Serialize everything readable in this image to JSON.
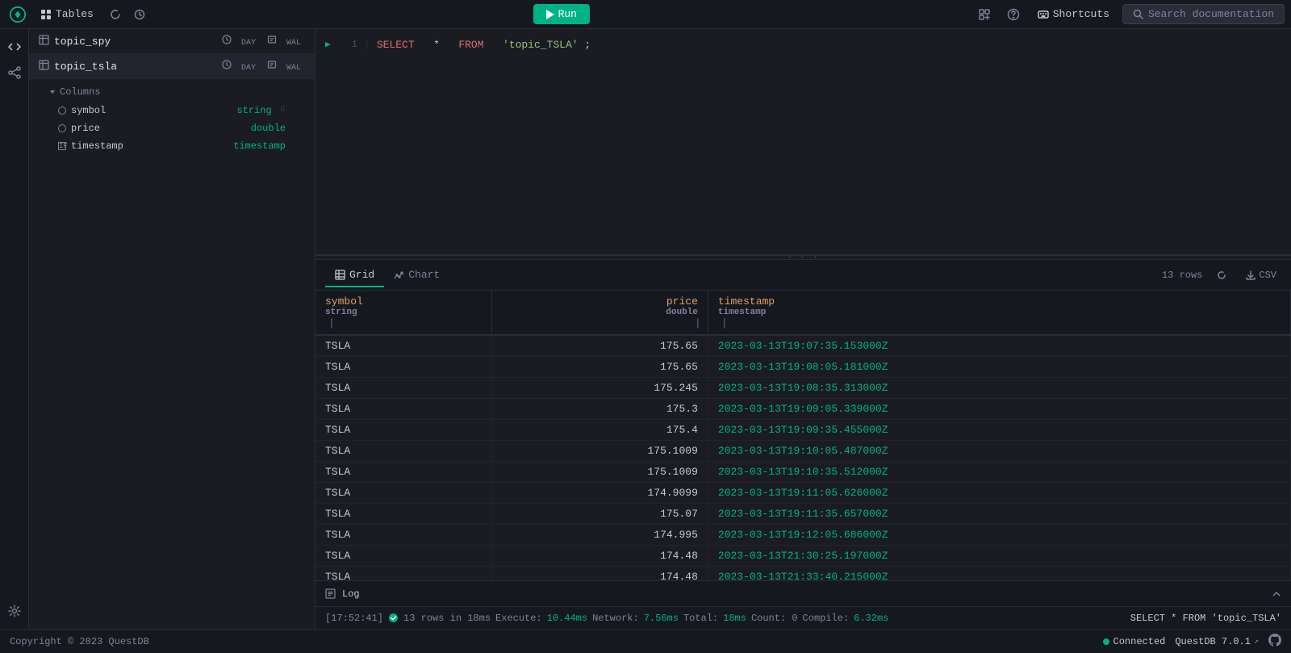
{
  "topNav": {
    "tablesLabel": "Tables",
    "runLabel": "Run",
    "shortcutsLabel": "Shortcuts",
    "searchDocLabel": "Search documentation"
  },
  "sidebar": {
    "icons": [
      "code",
      "share",
      "settings"
    ]
  },
  "tablesPanel": {
    "tables": [
      {
        "name": "topic_spy",
        "badge1": "DAY",
        "badge2": "WAL"
      },
      {
        "name": "topic_tsla",
        "badge1": "DAY",
        "badge2": "WAL",
        "expanded": true
      }
    ],
    "columnsHeader": "Columns",
    "columns": [
      {
        "name": "symbol",
        "type": "string",
        "indicator": "circle"
      },
      {
        "name": "price",
        "type": "double",
        "indicator": "circle"
      },
      {
        "name": "timestamp",
        "type": "timestamp",
        "indicator": "timestamp"
      }
    ]
  },
  "codeEditor": {
    "lineNumber": "1",
    "codeKeyword1": "SELECT",
    "codeStar": "*",
    "codeKeyword2": "FROM",
    "codeString": "'topic_TSLA'",
    "codeSemi": ";"
  },
  "resultsTabs": [
    {
      "id": "grid",
      "label": "Grid",
      "active": true
    },
    {
      "id": "chart",
      "label": "Chart",
      "active": false
    }
  ],
  "resultsBar": {
    "rowCount": "13 rows",
    "refreshLabel": "Refresh",
    "csvLabel": "CSV"
  },
  "tableHeaders": [
    {
      "name": "symbol",
      "type": "string"
    },
    {
      "name": "price",
      "type": "double"
    },
    {
      "name": "timestamp",
      "type": "timestamp"
    }
  ],
  "tableRows": [
    {
      "symbol": "TSLA",
      "price": "175.65",
      "timestamp": "2023-03-13T19:07:35.153000Z"
    },
    {
      "symbol": "TSLA",
      "price": "175.65",
      "timestamp": "2023-03-13T19:08:05.181000Z"
    },
    {
      "symbol": "TSLA",
      "price": "175.245",
      "timestamp": "2023-03-13T19:08:35.313000Z"
    },
    {
      "symbol": "TSLA",
      "price": "175.3",
      "timestamp": "2023-03-13T19:09:05.339000Z"
    },
    {
      "symbol": "TSLA",
      "price": "175.4",
      "timestamp": "2023-03-13T19:09:35.455000Z"
    },
    {
      "symbol": "TSLA",
      "price": "175.1009",
      "timestamp": "2023-03-13T19:10:05.487000Z"
    },
    {
      "symbol": "TSLA",
      "price": "175.1009",
      "timestamp": "2023-03-13T19:10:35.512000Z"
    },
    {
      "symbol": "TSLA",
      "price": "174.9099",
      "timestamp": "2023-03-13T19:11:05.626000Z"
    },
    {
      "symbol": "TSLA",
      "price": "175.07",
      "timestamp": "2023-03-13T19:11:35.657000Z"
    },
    {
      "symbol": "TSLA",
      "price": "174.995",
      "timestamp": "2023-03-13T19:12:05.686000Z"
    },
    {
      "symbol": "TSLA",
      "price": "174.48",
      "timestamp": "2023-03-13T21:30:25.197000Z"
    },
    {
      "symbol": "TSLA",
      "price": "174.48",
      "timestamp": "2023-03-13T21:33:40.215000Z"
    }
  ],
  "logBar": {
    "label": "Log"
  },
  "logStatus": {
    "timestamp": "[17:52:41]",
    "rowsInfo": "13 rows in 18ms",
    "executeLabel": "Execute:",
    "executeVal": "10.44ms",
    "networkLabel": "Network:",
    "networkVal": "7.56ms",
    "totalLabel": "Total:",
    "totalVal": "18ms",
    "countLabel": "Count: 0",
    "compileLabel": "Compile:",
    "compileVal": "6.32ms",
    "queryText": "SELECT * FROM 'topic_TSLA'"
  },
  "footer": {
    "copyright": "Copyright © 2023 QuestDB",
    "connected": "Connected",
    "version": "QuestDB 7.0.1"
  }
}
